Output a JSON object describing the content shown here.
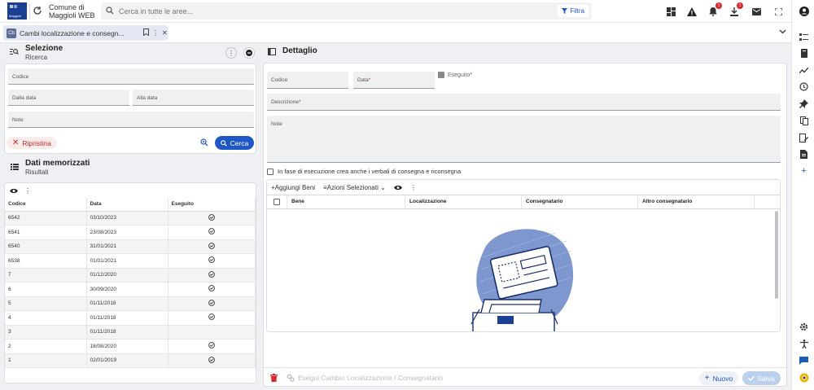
{
  "app": {
    "logo_text": "Maggioli",
    "name": "Comune di Maggioli WEB",
    "search_placeholder": "Cerca in tutte le aree...",
    "filter_label": "Filtra",
    "notifications_count": "1",
    "downloads_count": "1"
  },
  "tab": {
    "icon_text": "Cb",
    "label": "Cambi localizzazione e consegn..."
  },
  "selezione": {
    "title": "Selezione",
    "subtitle": "Ricerca",
    "fields": {
      "codice": "Codice",
      "dalla_data": "Dalla data",
      "alla_data": "Alla data",
      "note": "Note"
    },
    "reset_label": "Ripristina",
    "search_label": "Cerca"
  },
  "dati": {
    "title": "Dati memorizzati",
    "subtitle": "Risultati",
    "columns": [
      "Codice",
      "Data",
      "Eseguito"
    ],
    "rows": [
      {
        "codice": "6542",
        "data": "03/10/2023",
        "eseguito": true
      },
      {
        "codice": "6541",
        "data": "23/08/2023",
        "eseguito": true
      },
      {
        "codice": "6540",
        "data": "31/01/2021",
        "eseguito": true
      },
      {
        "codice": "6538",
        "data": "01/01/2021",
        "eseguito": true
      },
      {
        "codice": "7",
        "data": "01/12/2020",
        "eseguito": true
      },
      {
        "codice": "6",
        "data": "30/09/2020",
        "eseguito": true
      },
      {
        "codice": "5",
        "data": "01/11/2018",
        "eseguito": true
      },
      {
        "codice": "4",
        "data": "01/11/2018",
        "eseguito": true
      },
      {
        "codice": "3",
        "data": "01/11/2018",
        "eseguito": false
      },
      {
        "codice": "2",
        "data": "18/08/2020",
        "eseguito": true
      },
      {
        "codice": "1",
        "data": "02/01/2019",
        "eseguito": true
      }
    ]
  },
  "dettaglio": {
    "title": "Dettaglio",
    "codice_label": "Codice",
    "data_label": "Data",
    "eseguito_label": "Eseguito",
    "descrizione_label": "Descrizione",
    "note_label": "Note",
    "checkbox_label": "In fase di esecuzione crea anche i verbali di consegna e riconsegna",
    "aggiungi_label": "Aggiungi Beni",
    "azioni_label": "Azioni Selezionati",
    "bene_columns": [
      "Bene",
      "Localizzazione",
      "Consegnatario",
      "Altro consegnatario"
    ],
    "esegui_label": "Esegui Cambio Localizzazione / Consegnatario",
    "nuovo_label": "Nuovo",
    "salva_label": "Salva"
  },
  "colors": {
    "primary": "#1f57c4",
    "danger": "#c62828",
    "logo": "#1b3f93"
  }
}
